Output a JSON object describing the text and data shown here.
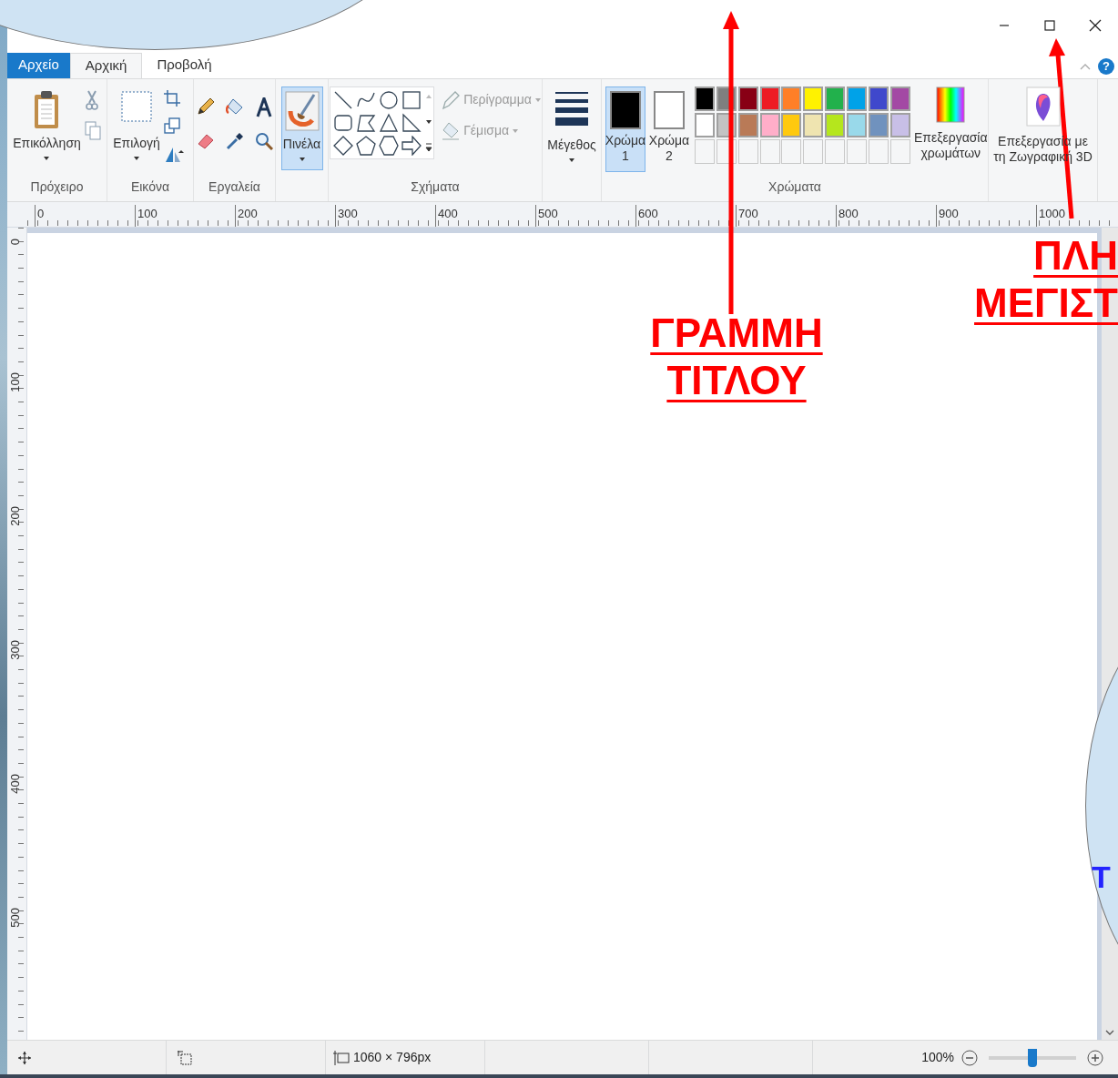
{
  "help": "?",
  "tabs": [
    {
      "label": "Αρχείο",
      "kind": "file",
      "selected": false
    },
    {
      "label": "Αρχική",
      "kind": "tab",
      "selected": true
    },
    {
      "label": "Προβολή",
      "kind": "tab",
      "selected": false
    }
  ],
  "ribbon": {
    "clipboard": {
      "paste": "Επικόλληση",
      "label": "Πρόχειρο"
    },
    "image": {
      "select": "Επιλογή",
      "label": "Εικόνα"
    },
    "tools": {
      "label": "Εργαλεία"
    },
    "brushes": {
      "label": "Πινέλα",
      "selected": true
    },
    "shapes": {
      "outline": {
        "label": "Περίγραμμα",
        "disabled": true
      },
      "fill": {
        "label": "Γέμισμα",
        "disabled": true
      },
      "label": "Σχήματα"
    },
    "size": {
      "label": "Μέγεθος"
    },
    "colors": {
      "color1": {
        "label": "Χρώμα",
        "number": "1",
        "selected": true,
        "color": "#000000"
      },
      "color2": {
        "label": "Χρώμα",
        "number": "2",
        "selected": false,
        "color": "#ffffff"
      },
      "palette": [
        {
          "color": "#000000"
        },
        {
          "color": "#7f7f7f"
        },
        {
          "color": "#880015"
        },
        {
          "color": "#ed1c24"
        },
        {
          "color": "#ff7f27"
        },
        {
          "color": "#fff200"
        },
        {
          "color": "#22b14c"
        },
        {
          "color": "#00a2e8"
        },
        {
          "color": "#3f48cc"
        },
        {
          "color": "#a349a4"
        },
        {
          "color": "#ffffff"
        },
        {
          "color": "#c3c3c3"
        },
        {
          "color": "#b97a57"
        },
        {
          "color": "#ffaec9"
        },
        {
          "color": "#ffc90e"
        },
        {
          "color": "#efe4b0"
        },
        {
          "color": "#b5e61d"
        },
        {
          "color": "#99d9ea"
        },
        {
          "color": "#7092be"
        },
        {
          "color": "#c8bfe7"
        }
      ],
      "edit": "Επεξεργασία χρωμάτων",
      "label": "Χρώματα"
    },
    "paint3d": {
      "label": "Επεξεργασία με τη Ζωγραφική 3D"
    }
  },
  "ruler": {
    "horizontal": [
      "0",
      "100",
      "200",
      "300",
      "400",
      "500",
      "600",
      "700",
      "800",
      "900",
      "1000"
    ],
    "vertical": [
      "0",
      "100",
      "200",
      "300",
      "400",
      "500"
    ]
  },
  "status_bar": {
    "dimensions": "1060 × 796px",
    "zoom": "100%",
    "zoom_slider": {
      "level": 0.5
    }
  },
  "annotations": [
    {
      "lines": [
        "ΓΡΑΜΜΗ",
        "ΤΙΤΛΟΥ"
      ]
    },
    {
      "lines": [
        "ΠΛΗ",
        "ΜΕΓΙΣΤ"
      ]
    }
  ],
  "callout": {
    "text": "Τ"
  }
}
